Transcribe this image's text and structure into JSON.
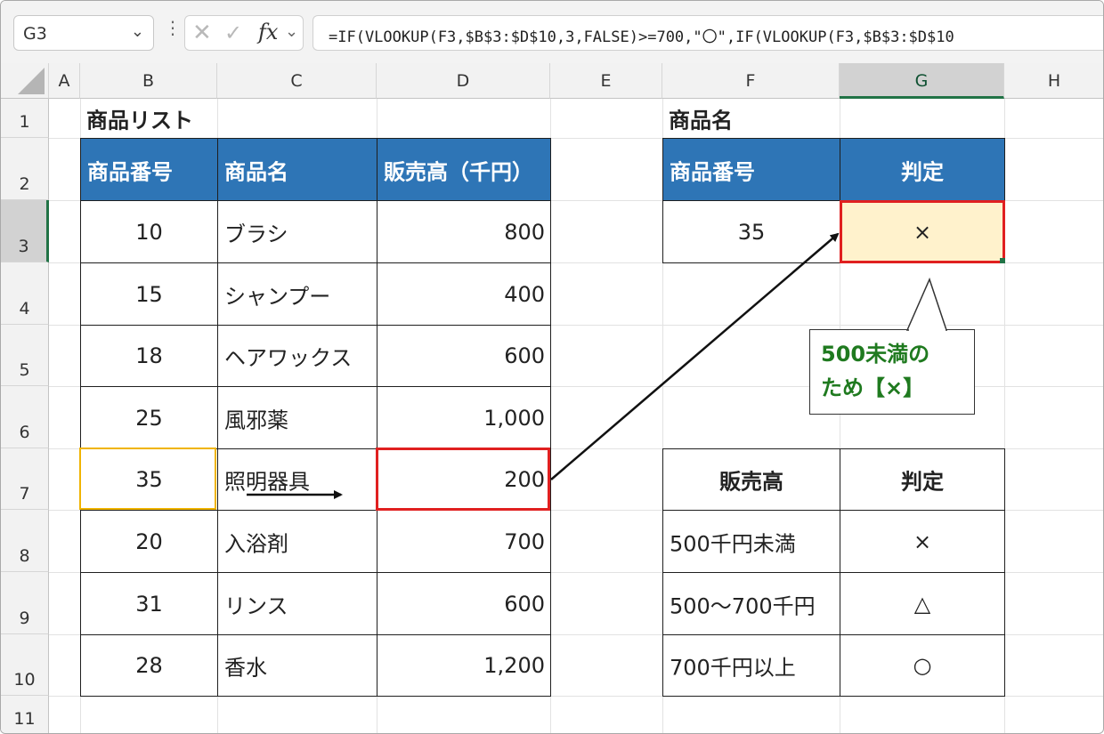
{
  "formula_bar": {
    "name_box": "G3",
    "cancel_icon": "✕",
    "enter_icon": "✓",
    "fx_label": "fx",
    "formula": "=IF(VLOOKUP(F3,$B$3:$D$10,3,FALSE)>=700,\"〇\",IF(VLOOKUP(F3,$B$3:$D$10"
  },
  "columns": [
    "A",
    "B",
    "C",
    "D",
    "E",
    "F",
    "G",
    "H"
  ],
  "rows": [
    "1",
    "2",
    "3",
    "4",
    "5",
    "6",
    "7",
    "8",
    "9",
    "10",
    "11"
  ],
  "selected_cell": "G3",
  "product_list": {
    "title": "商品リスト",
    "headers": [
      "商品番号",
      "商品名",
      "販売高（千円）"
    ],
    "rows": [
      {
        "no": "10",
        "name": "ブラシ",
        "sales": "800"
      },
      {
        "no": "15",
        "name": "シャンプー",
        "sales": "400"
      },
      {
        "no": "18",
        "name": "ヘアワックス",
        "sales": "600"
      },
      {
        "no": "25",
        "name": "風邪薬",
        "sales": "1,000"
      },
      {
        "no": "35",
        "name": "照明器具",
        "sales": "200"
      },
      {
        "no": "20",
        "name": "入浴剤",
        "sales": "700"
      },
      {
        "no": "31",
        "name": "リンス",
        "sales": "600"
      },
      {
        "no": "28",
        "name": "香水",
        "sales": "1,200"
      }
    ]
  },
  "lookup": {
    "title": "商品名",
    "headers": [
      "商品番号",
      "判定"
    ],
    "input": "35",
    "result": "×"
  },
  "criteria": {
    "headers": [
      "販売高",
      "判定"
    ],
    "rows": [
      {
        "range": "500千円未満",
        "mark": "×"
      },
      {
        "range": "500～700千円",
        "mark": "△"
      },
      {
        "range": "700千円以上",
        "mark": "○"
      }
    ]
  },
  "callout": {
    "line1": "500未満の",
    "line2": "ため【×】"
  },
  "colors": {
    "header_fill": "#2e75b6",
    "result_fill": "#fff2cc",
    "highlight_red": "#e02020",
    "highlight_orange": "#f0b400",
    "callout_text": "#1f7a1f",
    "excel_green": "#217346"
  }
}
